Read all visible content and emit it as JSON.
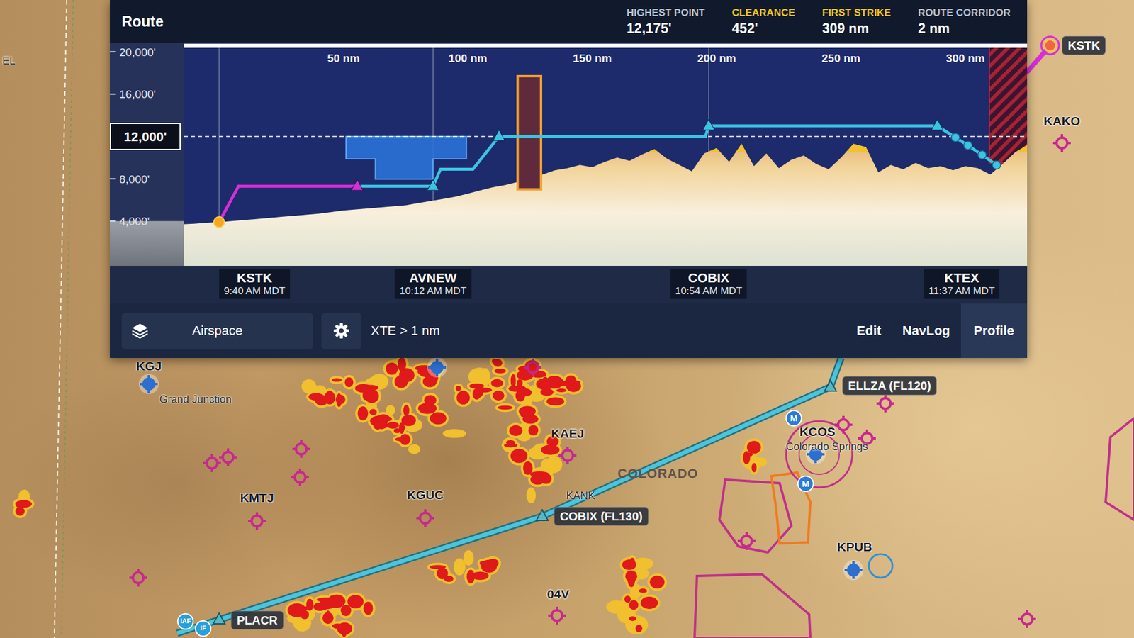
{
  "panel": {
    "title": "Route",
    "stats": [
      {
        "label": "HIGHEST POINT",
        "value": "12,175'",
        "color": "#b9c0cc"
      },
      {
        "label": "CLEARANCE",
        "value": "452'",
        "color": "#f2c51b"
      },
      {
        "label": "FIRST STRIKE",
        "value": "309 nm",
        "color": "#f2c51b"
      },
      {
        "label": "ROUTE CORRIDOR",
        "value": "2 nm",
        "color": "#b9c0cc"
      }
    ],
    "profile": {
      "y_ticks": [
        {
          "label": "20,000'",
          "value": 20000,
          "selected": false
        },
        {
          "label": "16,000'",
          "value": 16000,
          "selected": false
        },
        {
          "label": "12,000'",
          "value": 12000,
          "selected": true
        },
        {
          "label": "8,000'",
          "value": 8000,
          "selected": false
        },
        {
          "label": "4,000'",
          "value": 4000,
          "selected": false
        }
      ],
      "x_ticks": [
        {
          "label": "50 nm",
          "value": 50
        },
        {
          "label": "100 nm",
          "value": 100
        },
        {
          "label": "150 nm",
          "value": 150
        },
        {
          "label": "200 nm",
          "value": 200
        },
        {
          "label": "250 nm",
          "value": 250
        },
        {
          "label": "300 nm",
          "value": 300
        }
      ],
      "terrain": {
        "start_nm": -15,
        "step_nm": 5,
        "caution_above_ft": 10500,
        "elevation_ft": [
          3700,
          3750,
          3850,
          3900,
          4000,
          4100,
          4200,
          4300,
          4400,
          4500,
          4600,
          4700,
          4850,
          5000,
          5100,
          5200,
          5300,
          5400,
          5500,
          5700,
          5900,
          6100,
          6300,
          6600,
          6900,
          7200,
          7400,
          7700,
          8000,
          8400,
          8800,
          9000,
          9300,
          9100,
          9600,
          10000,
          9700,
          10300,
          10800,
          9900,
          9300,
          8700,
          10400,
          10900,
          9600,
          11300,
          9200,
          10400,
          9000,
          9800,
          10200,
          9400,
          8900,
          10000,
          11300,
          11000,
          8600,
          9300,
          8900,
          9500,
          9000,
          9200,
          8800,
          9200,
          9000,
          8400,
          9400,
          10500,
          11200
        ]
      },
      "route": [
        {
          "nm": 0,
          "ft": 3900,
          "marker": "origin"
        },
        {
          "nm": 7.8,
          "ft": 7300,
          "marker": "none",
          "leg_color": "#d62fd6"
        },
        {
          "nm": 55.5,
          "ft": 7300,
          "marker": "triangle",
          "leg_color": "#d62fd6"
        },
        {
          "nm": 86,
          "ft": 7300,
          "marker": "triangle",
          "leg_color": "#3cc3e2"
        },
        {
          "nm": 89,
          "ft": 8900,
          "marker": "none",
          "leg_color": "#3cc3e2"
        },
        {
          "nm": 102,
          "ft": 8900,
          "marker": "none",
          "leg_color": "#3cc3e2"
        },
        {
          "nm": 112.5,
          "ft": 12000,
          "marker": "triangle",
          "leg_color": "#3cc3e2"
        },
        {
          "nm": 195.5,
          "ft": 12000,
          "marker": "none",
          "leg_color": "#3cc3e2"
        },
        {
          "nm": 196.8,
          "ft": 13000,
          "marker": "triangle",
          "leg_color": "#3cc3e2"
        },
        {
          "nm": 288.7,
          "ft": 13000,
          "marker": "triangle",
          "leg_color": "#3cc3e2"
        },
        {
          "nm": 296,
          "ft": 11900,
          "marker": "dot",
          "leg_color": "#3cc3e2"
        },
        {
          "nm": 301,
          "ft": 11150,
          "marker": "dot",
          "leg_color": "#3cc3e2"
        },
        {
          "nm": 306.7,
          "ft": 10250,
          "marker": "dot",
          "leg_color": "#3cc3e2"
        },
        {
          "nm": 312.5,
          "ft": 9300,
          "marker": "dot",
          "leg_color": "#3cc3e2"
        }
      ],
      "zones": [
        {
          "kind": "strike",
          "points": [
            [
              309.6,
              20500
            ],
            [
              325,
              20500
            ],
            [
              325,
              9500
            ],
            [
              309.6,
              9500
            ]
          ]
        },
        {
          "kind": "airspace",
          "points": [
            [
              51,
              12000
            ],
            [
              99.4,
              12000
            ],
            [
              99.4,
              9880
            ],
            [
              86,
              9880
            ],
            [
              86,
              7970
            ],
            [
              62.8,
              7970
            ],
            [
              62.8,
              9880
            ],
            [
              51,
              9880
            ]
          ]
        },
        {
          "kind": "restricted",
          "points": [
            [
              120,
              17700
            ],
            [
              129.4,
              17700
            ],
            [
              129.4,
              7000
            ],
            [
              120,
              7000
            ]
          ]
        }
      ],
      "waypoints": [
        {
          "name": "KSTK",
          "time": "9:40 AM MDT",
          "nm": 0
        },
        {
          "name": "AVNEW",
          "time": "10:12 AM MDT",
          "nm": 86
        },
        {
          "name": "COBIX",
          "time": "10:54 AM MDT",
          "nm": 196.8
        },
        {
          "name": "KTEX",
          "time": "11:37 AM MDT",
          "nm": 313.7
        }
      ]
    },
    "toolbar": {
      "layers_button": "Airspace",
      "xte": "XTE > 1 nm",
      "tabs": [
        {
          "label": "Edit",
          "selected": false
        },
        {
          "label": "NavLog",
          "selected": false
        },
        {
          "label": "Profile",
          "selected": true
        }
      ]
    }
  },
  "map": {
    "places": [
      {
        "label": "KSTK",
        "kind": "origin"
      },
      {
        "label": "KAKO",
        "kind": "nontowered"
      },
      {
        "label": "KGJ",
        "kind": "towered"
      },
      {
        "label": "Grand Junction",
        "kind": "place"
      },
      {
        "label": "KMTJ",
        "kind": "nontowered"
      },
      {
        "label": "KGUC",
        "kind": "nontowered"
      },
      {
        "label": "KAEJ",
        "kind": "nontowered"
      },
      {
        "label": "KANK",
        "kind": "place"
      },
      {
        "label": "COBIX (FL130)",
        "kind": "fix"
      },
      {
        "label": "ELLZA (FL120)",
        "kind": "fix"
      },
      {
        "label": "KCOS",
        "kind": "towered"
      },
      {
        "label": "Colorado Springs",
        "kind": "place"
      },
      {
        "label": "KPUB",
        "kind": "towered"
      },
      {
        "label": "04V",
        "kind": "nontowered"
      },
      {
        "label": "PLACR",
        "kind": "fix"
      },
      {
        "label": "IAF",
        "kind": "approach"
      },
      {
        "label": "IF",
        "kind": "approach"
      },
      {
        "label": "EL",
        "kind": "place"
      },
      {
        "label": "COLORADO",
        "kind": "region"
      }
    ],
    "extra_pins": [
      {
        "kind": "nontowered"
      },
      {
        "kind": "nontowered"
      },
      {
        "kind": "nontowered"
      },
      {
        "kind": "nontowered"
      },
      {
        "kind": "nontowered"
      },
      {
        "kind": "nontowered"
      },
      {
        "kind": "nontowered"
      },
      {
        "kind": "nontowered"
      },
      {
        "kind": "nontowered"
      },
      {
        "kind": "nontowered"
      },
      {
        "kind": "nontowered"
      },
      {
        "kind": "towered"
      },
      {
        "kind": "military",
        "label": "M"
      },
      {
        "kind": "military",
        "label": "M"
      }
    ]
  }
}
